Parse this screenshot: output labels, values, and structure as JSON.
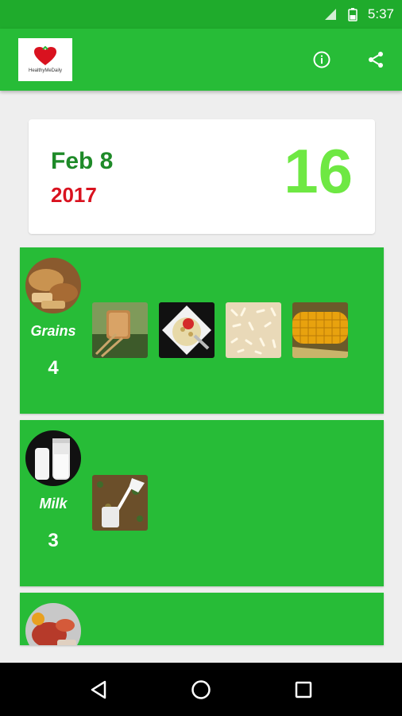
{
  "status_bar": {
    "time": "5:37"
  },
  "app": {
    "logo_text": "HealthyMeDaily"
  },
  "summary": {
    "month_day": "Feb 8",
    "year": "2017",
    "total": "16"
  },
  "groups": [
    {
      "name": "Grains",
      "count": "4"
    },
    {
      "name": "Milk",
      "count": "3"
    },
    {
      "name": "",
      "count": ""
    }
  ],
  "icons": {
    "info": "info-icon",
    "share": "share-icon",
    "back": "back-icon",
    "home": "home-icon",
    "recents": "recents-icon"
  },
  "colors": {
    "status_bar": "#1fab2c",
    "app_bar": "#27bc37",
    "card_green": "#27bc37",
    "date_green": "#1e8a28",
    "year_red": "#d9121f",
    "count_green": "#6ee843"
  }
}
